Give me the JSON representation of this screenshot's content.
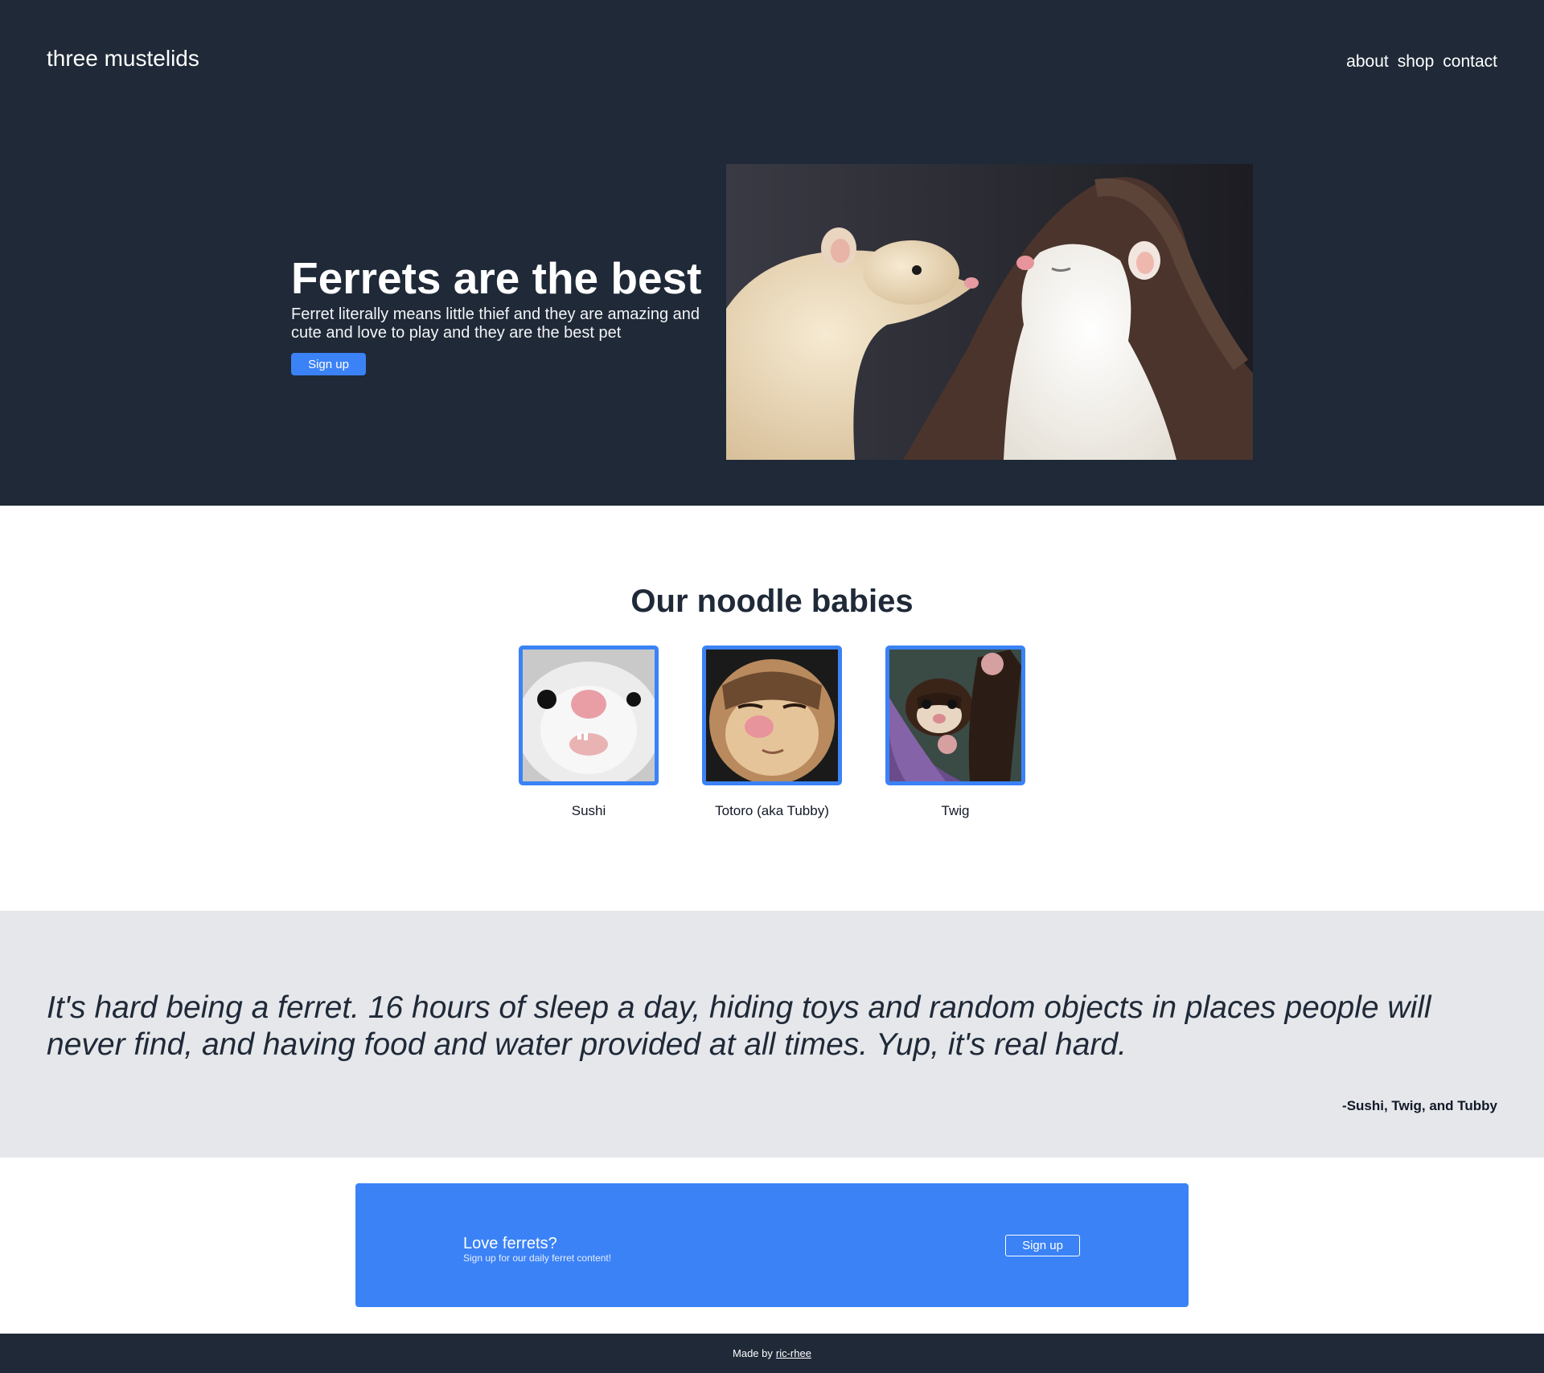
{
  "header": {
    "brand": "three mustelids",
    "nav": [
      "about",
      "shop",
      "contact"
    ]
  },
  "hero": {
    "title": "Ferrets are the best",
    "subtitle": "Ferret literally means little thief and they are amazing and cute and love to play and they are the best pet",
    "cta_label": "Sign up",
    "image_icon": "two-ferrets-photo"
  },
  "babies": {
    "title": "Our noodle babies",
    "items": [
      {
        "name": "Sushi",
        "image_icon": "white-ferret-photo"
      },
      {
        "name": "Totoro (aka Tubby)",
        "image_icon": "sable-ferret-photo"
      },
      {
        "name": "Twig",
        "image_icon": "dark-ferret-photo"
      }
    ]
  },
  "quote": {
    "text": "It's hard being a ferret. 16 hours of sleep a day, hiding toys and random objects in places people will never find, and having food and water provided at all times. Yup, it's real hard.",
    "author": "-Sushi, Twig, and Tubby"
  },
  "cta": {
    "title": "Love ferrets?",
    "subtitle": "Sign up for our daily ferret content!",
    "button_label": "Sign up"
  },
  "footer": {
    "prefix": "Made by",
    "link_text": "ric-rhee"
  },
  "colors": {
    "dark": "#1f2937",
    "accent": "#3b82f6",
    "quote_bg": "#e5e7eb"
  }
}
